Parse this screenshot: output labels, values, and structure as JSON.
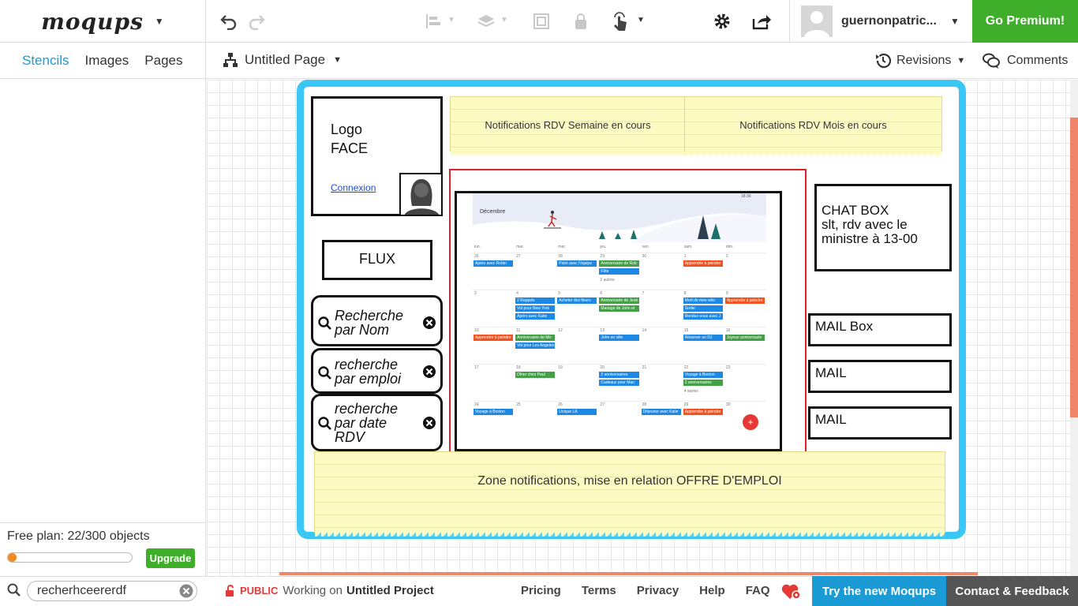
{
  "app": {
    "logo": "moqups"
  },
  "toolbar": {
    "username": "guernonpatric...",
    "premium_label": "Go Premium!"
  },
  "left_tabs": [
    {
      "label": "Stencils"
    },
    {
      "label": "Images"
    },
    {
      "label": "Pages"
    }
  ],
  "page": {
    "name": "Untitled Page"
  },
  "right_actions": {
    "revisions": "Revisions",
    "comments": "Comments"
  },
  "plan": {
    "label": "Free plan: 22/300 objects",
    "usage_fraction": 0.073,
    "upgrade": "Upgrade"
  },
  "mockup": {
    "logo_line1": "Logo",
    "logo_line2": "FACE",
    "connexion": "Connexion",
    "notif_week": "Notifications RDV Semaine en cours",
    "notif_month": "Notifications RDV Mois en cours",
    "flux": "FLUX",
    "search1_line1": "Recherche",
    "search1_line2": "par Nom",
    "search2_line1": "recherche",
    "search2_line2": "par emploi",
    "search3_line1": "recherche",
    "search3_line2": "par date",
    "search3_line3": "RDV",
    "chat_title": "CHAT BOX",
    "chat_line2": "slt, rdv avec le",
    "chat_line3": "ministre à 13-00",
    "mail_box": "MAIL Box",
    "mail2": "MAIL",
    "mail3": "MAIL",
    "zone_notif": "Zone notifications, mise en relation OFFRE D'EMPLOI",
    "calendar": {
      "month": "Décembre",
      "time": "18:30",
      "days": [
        "lun.",
        "mar.",
        "mer.",
        "jeu.",
        "ven.",
        "sam.",
        "dim."
      ],
      "weeks": [
        [
          "26",
          "27",
          "28",
          "29",
          "30",
          "1",
          "2"
        ],
        [
          "3",
          "4",
          "5",
          "6",
          "7",
          "8",
          "9"
        ],
        [
          "10",
          "11",
          "12",
          "13",
          "14",
          "15",
          "16"
        ],
        [
          "17",
          "18",
          "19",
          "20",
          "21",
          "22",
          "23"
        ],
        [
          "24",
          "25",
          "26",
          "27",
          "28",
          "29",
          "30"
        ]
      ],
      "events": [
        {
          "label": "Apéro avec Robin",
          "color": "#1e88e5"
        },
        {
          "label": "Point avec l'équipe",
          "color": "#1e88e5"
        },
        {
          "label": "Anniversaire de Rob",
          "color": "#43a047"
        },
        {
          "label": "Fête",
          "color": "#1e88e5"
        },
        {
          "label": "Apprendre à peindre",
          "color": "#f4511e"
        },
        {
          "label": "2 Rappels",
          "color": "#1e88e5"
        },
        {
          "label": "Vol pour New York",
          "color": "#1e88e5"
        },
        {
          "label": "Apéro avec Katie",
          "color": "#1e88e5"
        },
        {
          "label": "Acheter des fleurs",
          "color": "#1e88e5"
        },
        {
          "label": "Anniversaire de Jean",
          "color": "#43a047"
        },
        {
          "label": "Mariage de John et",
          "color": "#43a047"
        },
        {
          "label": "Mort de mes vélo",
          "color": "#1e88e5"
        },
        {
          "label": "Sortie",
          "color": "#1e88e5"
        },
        {
          "label": "Rendez-vous avec J",
          "color": "#1e88e5"
        },
        {
          "label": "Apprendre à peindre",
          "color": "#f4511e"
        },
        {
          "label": "Apprendre à peindre",
          "color": "#f4511e"
        },
        {
          "label": "Anniversaire de Mic",
          "color": "#43a047"
        },
        {
          "label": "Vol pour Los Angeles",
          "color": "#1e88e5"
        },
        {
          "label": "John en ville",
          "color": "#1e88e5"
        },
        {
          "label": "Réserver un DJ",
          "color": "#1e88e5"
        },
        {
          "label": "Joyeux anniversaire",
          "color": "#43a047"
        },
        {
          "label": "Dîner chez Paul",
          "color": "#43a047"
        },
        {
          "label": "2 anniversaires",
          "color": "#1e88e5"
        },
        {
          "label": "Cadeaux pour Mari",
          "color": "#1e88e5"
        },
        {
          "label": "Voyage à Boston",
          "color": "#1e88e5"
        },
        {
          "label": "2 anniversaires",
          "color": "#43a047"
        },
        {
          "label": "Voyage à Boston",
          "color": "#1e88e5"
        },
        {
          "label": "Unique LA",
          "color": "#1e88e5"
        },
        {
          "label": "Déjeuner avec Katie",
          "color": "#1e88e5"
        },
        {
          "label": "Apprendre à peindre",
          "color": "#f4511e"
        }
      ],
      "more1": "2 autres",
      "more2": "4 autres"
    }
  },
  "footer": {
    "search_value": "recherhceererdf",
    "public_label": "PUBLIC",
    "working_on": "Working on",
    "project": "Untitled Project",
    "links": [
      "Pricing",
      "Terms",
      "Privacy",
      "Help",
      "FAQ"
    ],
    "try_new": "Try the new Moqups",
    "contact": "Contact & Feedback"
  }
}
